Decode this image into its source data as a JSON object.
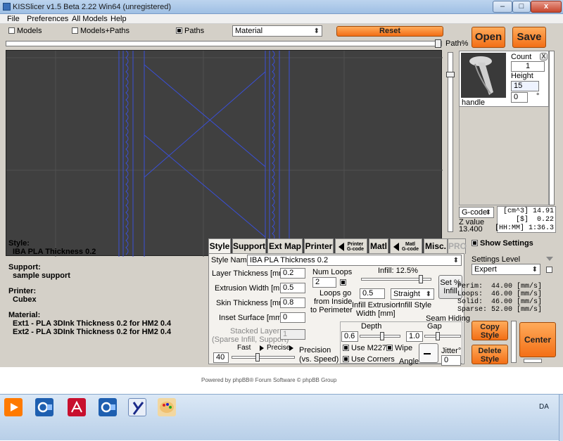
{
  "window": {
    "title": "KISSlicer v1.5 Beta 2.22 Win64 (unregistered)",
    "minimize_label": "–",
    "maximize_label": "□",
    "close_label": "x"
  },
  "menu": [
    "File",
    "Preferences",
    "All Models",
    "Help"
  ],
  "view": {
    "models_label": "Models",
    "models_paths_label": "Models+Paths",
    "paths_label": "Paths",
    "paths_checked": true,
    "material_select": "Material",
    "reset_label": "Reset",
    "open_label": "Open",
    "save_label": "Save",
    "path_pct_label": "Path%"
  },
  "model": {
    "name": "handle",
    "count_label": "Count",
    "count_value": "1",
    "height_label": "Height",
    "height_value": "15",
    "angle_value": "0",
    "degree_symbol": "°",
    "close_label": "X"
  },
  "gcode": {
    "select": "G-code",
    "zlabel": "Z value",
    "zvalue": "13.400",
    "stats": [
      "[cm^3] 14.91",
      "[$]  0.22",
      "[HH:MM] 1:36.3"
    ]
  },
  "tabs": {
    "style": "Style",
    "support": "Support",
    "extmap": "Ext Map",
    "printer": "Printer",
    "printer_gcode_top": "Printer",
    "printer_gcode_bottom": "G-code",
    "matl": "Matl",
    "matl_gcode_top": "Matl",
    "matl_gcode_bottom": "G-code",
    "misc": "Misc.",
    "pro": "PRO"
  },
  "style": {
    "name_label": "Style Name",
    "name_value": "IBA PLA Thickness 0.2",
    "layer_label": "Layer Thickness [mm]",
    "layer_value": "0.2",
    "extrusion_label": "Extrusion Width [mm]",
    "extrusion_value": "0.5",
    "skin_label": "Skin Thickness [mm]",
    "skin_value": "0.8",
    "inset_label": "Inset  Surface [mm]",
    "inset_value": "0",
    "stacked_label": "Stacked Layers",
    "stacked_sub": "(Sparse Infill, Support)",
    "stacked_value": "1",
    "fast_label": "Fast",
    "precise_label": "Precise",
    "precision_value": "40",
    "precision_label": "Precision",
    "precision_sub": "(vs. Speed)",
    "numloops_label": "Num Loops",
    "numloops_value": "2",
    "loops_go_1": "Loops go",
    "loops_go_2": "from Inside",
    "loops_go_3": "to Perimeter",
    "infill_label": "Infill: 12.5%",
    "infill_ext_value": "0.5",
    "infill_ext_label": "Infill Extrusion",
    "infill_ext_unit": "Width [mm]",
    "infill_style_value": "Straight",
    "infill_style_label": "Infill Style",
    "set_pct_1": "Set %",
    "set_pct_2": "Infill",
    "seam_label_1": "Seam Hiding",
    "depth_label": "Depth",
    "gap_label": "Gap",
    "depth_value": "0.6",
    "gap_value": "1.0",
    "use_m227": "Use M227",
    "wipe": "Wipe",
    "use_corners": "Use Corners",
    "angle_label": "Angle",
    "jitter_label": "Jitter°",
    "jitter_value": "0"
  },
  "summary": {
    "style_label": "Style:",
    "style_value": "IBA PLA Thickness 0.2",
    "support_label": "Support:",
    "support_value": "sample support",
    "printer_label": "Printer:",
    "printer_value": "Cubex",
    "material_label": "Material:",
    "ext1": "Ext1 - PLA 3DInk Thickness 0.2 for HM2 0.4",
    "ext2": "Ext2 - PLA 3DInk Thickness 0.2 for HM2 0.4"
  },
  "settings": {
    "show_label": "Show Settings",
    "level_label": "Settings Level",
    "level_value": "Expert",
    "speeds": [
      "Perim:  44.00 [mm/s]",
      "Loops:  46.00 [mm/s]",
      "Solid:  46.00 [mm/s]",
      "Sparse: 52.00 [mm/s]"
    ],
    "copy_1": "Copy",
    "copy_2": "Style",
    "delete_1": "Delete",
    "delete_2": "Style",
    "center_label": "Center"
  },
  "footer": "Powered by phpBB® Forum Software © phpBB Group",
  "taskbar": {
    "lang": "DA"
  },
  "colors": {
    "accent": "#f36f16",
    "viewport": "#404040",
    "toolpath": "#3a4fd8"
  }
}
